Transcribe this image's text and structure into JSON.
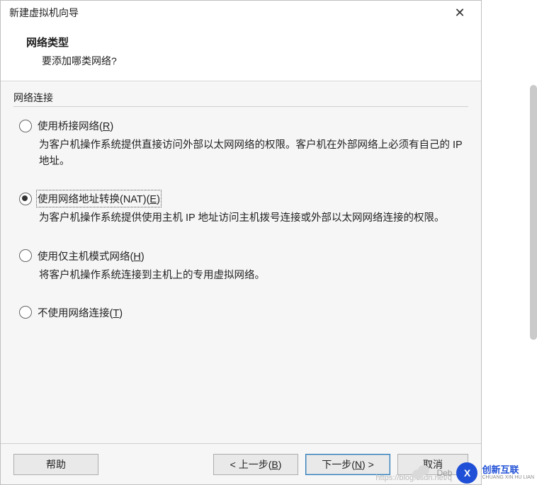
{
  "window": {
    "title": "新建虚拟机向导"
  },
  "header": {
    "title": "网络类型",
    "subtitle": "要添加哪类网络?"
  },
  "group": {
    "title": "网络连接"
  },
  "options": {
    "bridged": {
      "label_pre": "使用桥接网络(",
      "accel": "R",
      "label_post": ")",
      "desc": "为客户机操作系统提供直接访问外部以太网网络的权限。客户机在外部网络上必须有自己的 IP 地址。",
      "checked": false
    },
    "nat": {
      "label_pre": "使用网络地址转换(NAT)(",
      "accel": "E",
      "label_post": ")",
      "desc": "为客户机操作系统提供使用主机 IP 地址访问主机拨号连接或外部以太网网络连接的权限。",
      "checked": true
    },
    "hostonly": {
      "label_pre": "使用仅主机模式网络(",
      "accel": "H",
      "label_post": ")",
      "desc": "将客户机操作系统连接到主机上的专用虚拟网络。",
      "checked": false
    },
    "none": {
      "label_pre": "不使用网络连接(",
      "accel": "T",
      "label_post": ")",
      "checked": false
    }
  },
  "buttons": {
    "help": "帮助",
    "back_pre": "< 上一步(",
    "back_accel": "B",
    "back_post": ")",
    "next_pre": "下一步(",
    "next_accel": "N",
    "next_post": ") >",
    "cancel": "取消"
  },
  "watermark": {
    "text_top": "创新互联",
    "text_bottom": "CHUANG XIN HU LIAN",
    "logo": "X",
    "chat_text": "Deb",
    "blog_url": "https://blog.csdn.net/q"
  }
}
